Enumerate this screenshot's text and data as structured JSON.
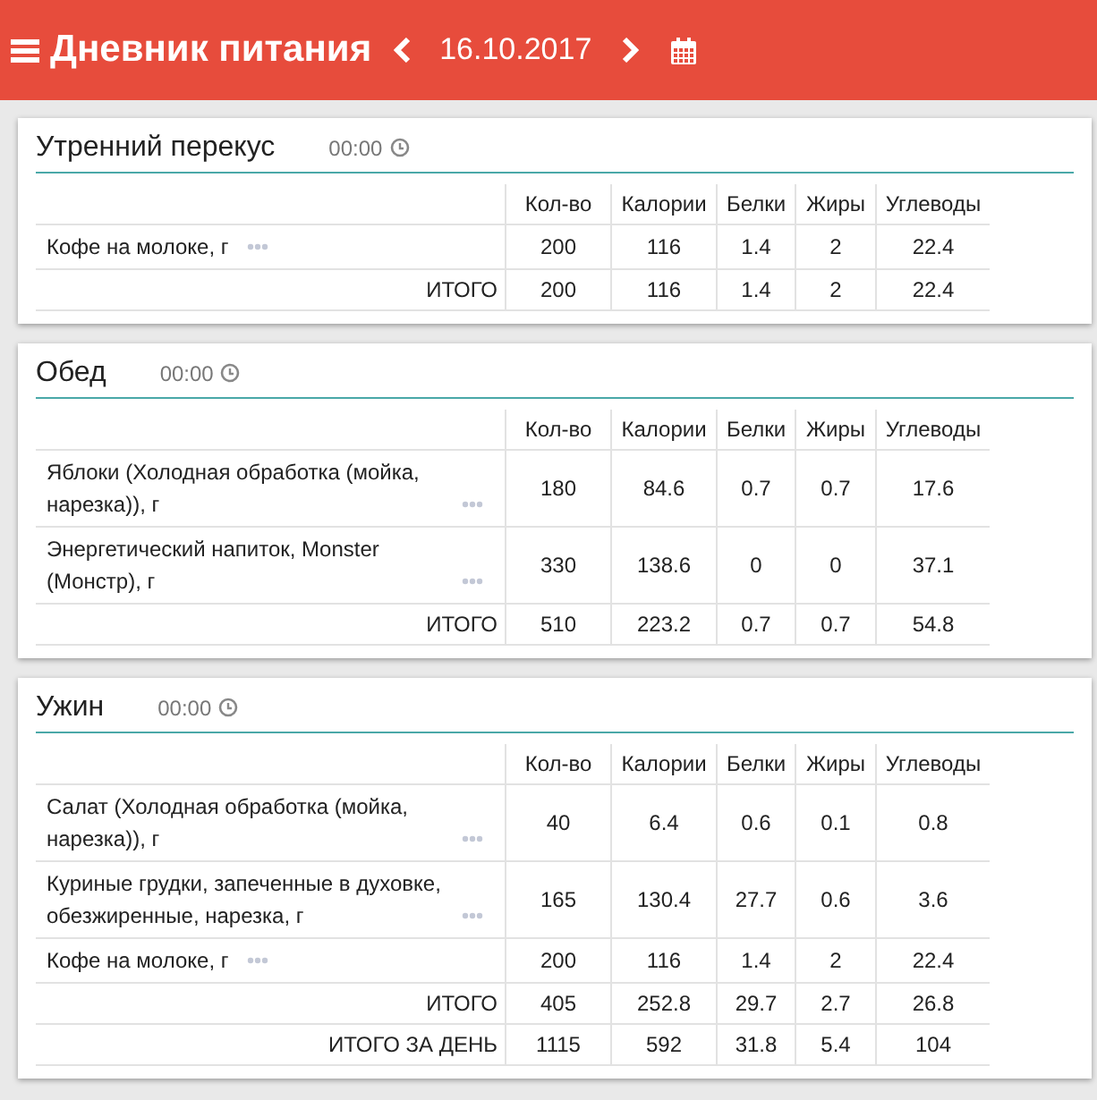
{
  "header": {
    "title": "Дневник питания",
    "date": "16.10.2017"
  },
  "meals": [
    {
      "title": "Утренний перекус",
      "time": "00:00",
      "columns": [
        "Кол-во",
        "Калории",
        "Белки",
        "Жиры",
        "Углеводы"
      ],
      "items": [
        {
          "name": "Кофе на молоке, г",
          "values": [
            "200",
            "116",
            "1.4",
            "2",
            "22.4"
          ]
        }
      ],
      "totals": [
        {
          "label": "ИТОГО",
          "values": [
            "200",
            "116",
            "1.4",
            "2",
            "22.4"
          ]
        }
      ]
    },
    {
      "title": "Обед",
      "time": "00:00",
      "columns": [
        "Кол-во",
        "Калории",
        "Белки",
        "Жиры",
        "Углеводы"
      ],
      "items": [
        {
          "name": "Яблоки (Холодная обработка (мойка, нарезка)), г",
          "values": [
            "180",
            "84.6",
            "0.7",
            "0.7",
            "17.6"
          ]
        },
        {
          "name": "Энергетический напиток, Monster (Монстр), г",
          "values": [
            "330",
            "138.6",
            "0",
            "0",
            "37.1"
          ]
        }
      ],
      "totals": [
        {
          "label": "ИТОГО",
          "values": [
            "510",
            "223.2",
            "0.7",
            "0.7",
            "54.8"
          ]
        }
      ]
    },
    {
      "title": "Ужин",
      "time": "00:00",
      "columns": [
        "Кол-во",
        "Калории",
        "Белки",
        "Жиры",
        "Углеводы"
      ],
      "items": [
        {
          "name": "Салат (Холодная обработка (мойка, нарезка)), г",
          "values": [
            "40",
            "6.4",
            "0.6",
            "0.1",
            "0.8"
          ]
        },
        {
          "name": "Куриные грудки, запеченные в духовке, обезжиренные, нарезка, г",
          "values": [
            "165",
            "130.4",
            "27.7",
            "0.6",
            "3.6"
          ]
        },
        {
          "name": "Кофе на молоке, г",
          "values": [
            "200",
            "116",
            "1.4",
            "2",
            "22.4"
          ]
        }
      ],
      "totals": [
        {
          "label": "ИТОГО",
          "values": [
            "405",
            "252.8",
            "29.7",
            "2.7",
            "26.8"
          ]
        },
        {
          "label": "ИТОГО ЗА ДЕНЬ",
          "values": [
            "1115",
            "592",
            "31.8",
            "5.4",
            "104"
          ]
        }
      ]
    }
  ]
}
